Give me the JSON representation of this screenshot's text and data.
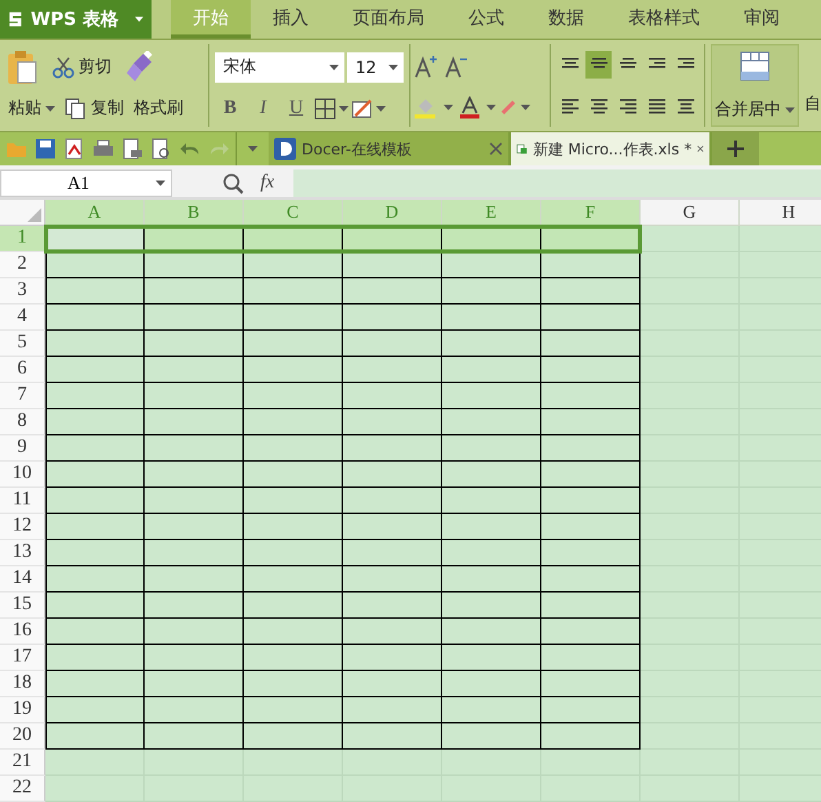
{
  "app_menu": {
    "label": "WPS 表格"
  },
  "menu_tabs": [
    {
      "label": "开始",
      "selected": true
    },
    {
      "label": "插入",
      "selected": false
    },
    {
      "label": "页面布局",
      "selected": false
    },
    {
      "label": "公式",
      "selected": false
    },
    {
      "label": "数据",
      "selected": false
    },
    {
      "label": "表格样式",
      "selected": false
    },
    {
      "label": "审阅",
      "selected": false
    }
  ],
  "ribbon": {
    "paste": "粘贴",
    "cut": "剪切",
    "copy": "复制",
    "format_painter": "格式刷",
    "font_name": "宋体",
    "font_size": "12",
    "style_buttons": [
      "B",
      "I",
      "U"
    ],
    "merge": "合并居中",
    "cut_off": "自"
  },
  "doc_tabs": [
    {
      "label": "Docer-在线模板",
      "selected": false
    },
    {
      "label": "新建 Micro...作表.xls *",
      "selected": true
    }
  ],
  "formula_bar": {
    "name_box": "A1",
    "fx": "fx"
  },
  "sheet": {
    "columns": [
      {
        "label": "A",
        "selected": true,
        "active": true,
        "bordered": true
      },
      {
        "label": "B",
        "selected": true,
        "active": false,
        "bordered": true
      },
      {
        "label": "C",
        "selected": true,
        "active": false,
        "bordered": true
      },
      {
        "label": "D",
        "selected": true,
        "active": false,
        "bordered": true
      },
      {
        "label": "E",
        "selected": true,
        "active": false,
        "bordered": true
      },
      {
        "label": "F",
        "selected": true,
        "active": false,
        "bordered": true
      },
      {
        "label": "G",
        "selected": false,
        "active": false,
        "bordered": false
      },
      {
        "label": "H",
        "selected": false,
        "active": false,
        "bordered": false
      }
    ],
    "rows": [
      {
        "label": "1",
        "selected": true,
        "active": true,
        "bordered": true
      },
      {
        "label": "2",
        "selected": false,
        "active": false,
        "bordered": true
      },
      {
        "label": "3",
        "selected": false,
        "active": false,
        "bordered": true
      },
      {
        "label": "4",
        "selected": false,
        "active": false,
        "bordered": true
      },
      {
        "label": "5",
        "selected": false,
        "active": false,
        "bordered": true
      },
      {
        "label": "6",
        "selected": false,
        "active": false,
        "bordered": true
      },
      {
        "label": "7",
        "selected": false,
        "active": false,
        "bordered": true
      },
      {
        "label": "8",
        "selected": false,
        "active": false,
        "bordered": true
      },
      {
        "label": "9",
        "selected": false,
        "active": false,
        "bordered": true
      },
      {
        "label": "10",
        "selected": false,
        "active": false,
        "bordered": true
      },
      {
        "label": "11",
        "selected": false,
        "active": false,
        "bordered": true
      },
      {
        "label": "12",
        "selected": false,
        "active": false,
        "bordered": true
      },
      {
        "label": "13",
        "selected": false,
        "active": false,
        "bordered": true
      },
      {
        "label": "14",
        "selected": false,
        "active": false,
        "bordered": true
      },
      {
        "label": "15",
        "selected": false,
        "active": false,
        "bordered": true
      },
      {
        "label": "16",
        "selected": false,
        "active": false,
        "bordered": true
      },
      {
        "label": "17",
        "selected": false,
        "active": false,
        "bordered": true
      },
      {
        "label": "18",
        "selected": false,
        "active": false,
        "bordered": true
      },
      {
        "label": "19",
        "selected": false,
        "active": false,
        "bordered": true
      },
      {
        "label": "20",
        "selected": false,
        "active": false,
        "bordered": true
      },
      {
        "label": "21",
        "selected": false,
        "active": false,
        "bordered": false
      },
      {
        "label": "22",
        "selected": false,
        "active": false,
        "bordered": false
      }
    ]
  }
}
